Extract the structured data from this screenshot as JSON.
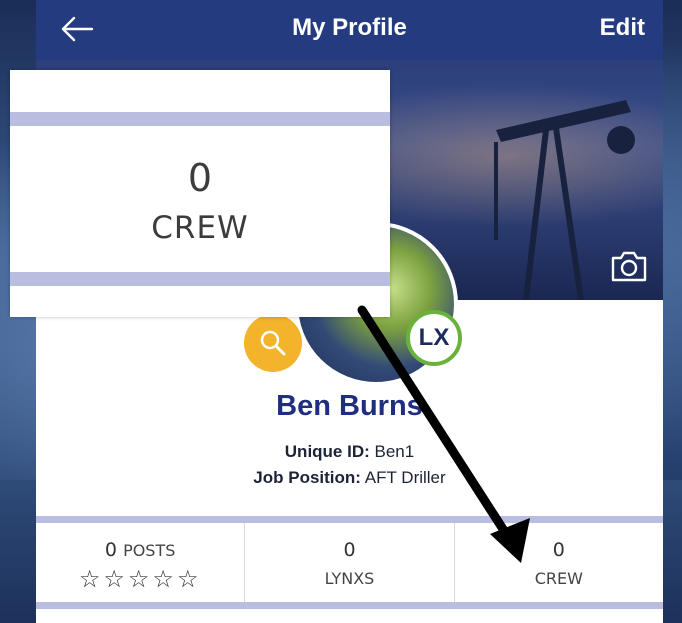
{
  "header": {
    "title": "My Profile",
    "edit_label": "Edit",
    "back_icon": "arrow-left-icon"
  },
  "cover": {
    "camera_icon": "camera-icon"
  },
  "avatar": {
    "search_badge_icon": "magnifier-icon",
    "lx_badge": "LX"
  },
  "profile": {
    "name": "Ben Burns",
    "unique_id_label": "Unique ID:",
    "unique_id": "Ben1",
    "job_position_label": "Job Position:",
    "job_position": "AFT Driller"
  },
  "stats": {
    "posts_count": "0",
    "posts_label": "POSTS",
    "stars": "☆☆☆☆☆",
    "lynxs_count": "0",
    "lynxs_label": "LYNXS",
    "crew_count": "0",
    "crew_label": "CREW"
  },
  "zoom": {
    "count": "0",
    "label": "CREW"
  },
  "colors": {
    "header_bg": "#243b80",
    "name_color": "#1f2e80",
    "divider": "#b9bde0",
    "search_badge": "#f3b32a",
    "lx_ring": "#69b33a"
  }
}
